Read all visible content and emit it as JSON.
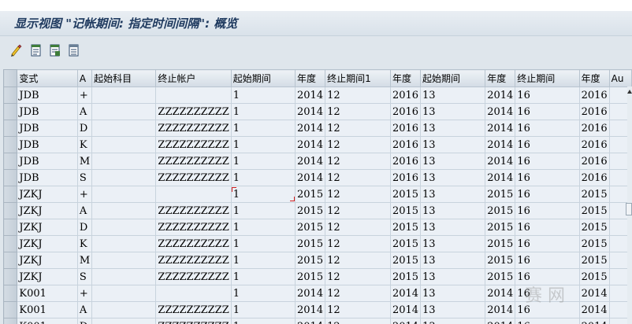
{
  "window": {
    "title": "显示视图 \"记帐期间: 指定时间间隔\": 概览"
  },
  "toolbar": {
    "buttons": [
      "display-change-icon",
      "list-doc-icon",
      "list-doc-icon-2",
      "list-doc-icon-3"
    ]
  },
  "table": {
    "columns": [
      "变式",
      "A",
      "起始科目",
      "终止帐户",
      "起始期间",
      "年度",
      "终止期间1",
      "年度",
      "起始期间",
      "年度",
      "终止期间",
      "年度",
      "Au"
    ],
    "rows": [
      [
        "JDB",
        "+",
        "",
        "",
        "1",
        "2014",
        "12",
        "2016",
        "13",
        "2014",
        "16",
        "2016"
      ],
      [
        "JDB",
        "A",
        "",
        "ZZZZZZZZZZ",
        "1",
        "2014",
        "12",
        "2016",
        "13",
        "2014",
        "16",
        "2016"
      ],
      [
        "JDB",
        "D",
        "",
        "ZZZZZZZZZZ",
        "1",
        "2014",
        "12",
        "2016",
        "13",
        "2014",
        "16",
        "2016"
      ],
      [
        "JDB",
        "K",
        "",
        "ZZZZZZZZZZ",
        "1",
        "2014",
        "12",
        "2016",
        "13",
        "2014",
        "16",
        "2016"
      ],
      [
        "JDB",
        "M",
        "",
        "ZZZZZZZZZZ",
        "1",
        "2014",
        "12",
        "2016",
        "13",
        "2014",
        "16",
        "2016"
      ],
      [
        "JDB",
        "S",
        "",
        "ZZZZZZZZZZ",
        "1",
        "2014",
        "12",
        "2016",
        "13",
        "2014",
        "16",
        "2016"
      ],
      [
        "JZKJ",
        "+",
        "",
        "",
        "1",
        "2015",
        "12",
        "2015",
        "13",
        "2015",
        "16",
        "2015"
      ],
      [
        "JZKJ",
        "A",
        "",
        "ZZZZZZZZZZ",
        "1",
        "2015",
        "12",
        "2015",
        "13",
        "2015",
        "16",
        "2015"
      ],
      [
        "JZKJ",
        "D",
        "",
        "ZZZZZZZZZZ",
        "1",
        "2015",
        "12",
        "2015",
        "13",
        "2015",
        "16",
        "2015"
      ],
      [
        "JZKJ",
        "K",
        "",
        "ZZZZZZZZZZ",
        "1",
        "2015",
        "12",
        "2015",
        "13",
        "2015",
        "16",
        "2015"
      ],
      [
        "JZKJ",
        "M",
        "",
        "ZZZZZZZZZZ",
        "1",
        "2015",
        "12",
        "2015",
        "13",
        "2015",
        "16",
        "2015"
      ],
      [
        "JZKJ",
        "S",
        "",
        "ZZZZZZZZZZ",
        "1",
        "2015",
        "12",
        "2015",
        "13",
        "2015",
        "16",
        "2015"
      ],
      [
        "K001",
        "+",
        "",
        "",
        "1",
        "2014",
        "12",
        "2014",
        "13",
        "2014",
        "16",
        "2014"
      ],
      [
        "K001",
        "A",
        "",
        "ZZZZZZZZZZ",
        "1",
        "2014",
        "12",
        "2014",
        "13",
        "2014",
        "16",
        "2014"
      ],
      [
        "K001",
        "D",
        "",
        "ZZZZZZZZZZ",
        "1",
        "2014",
        "12",
        "2014",
        "13",
        "2014",
        "16",
        "2014"
      ]
    ]
  },
  "watermark": {
    "text": "赛   网"
  }
}
